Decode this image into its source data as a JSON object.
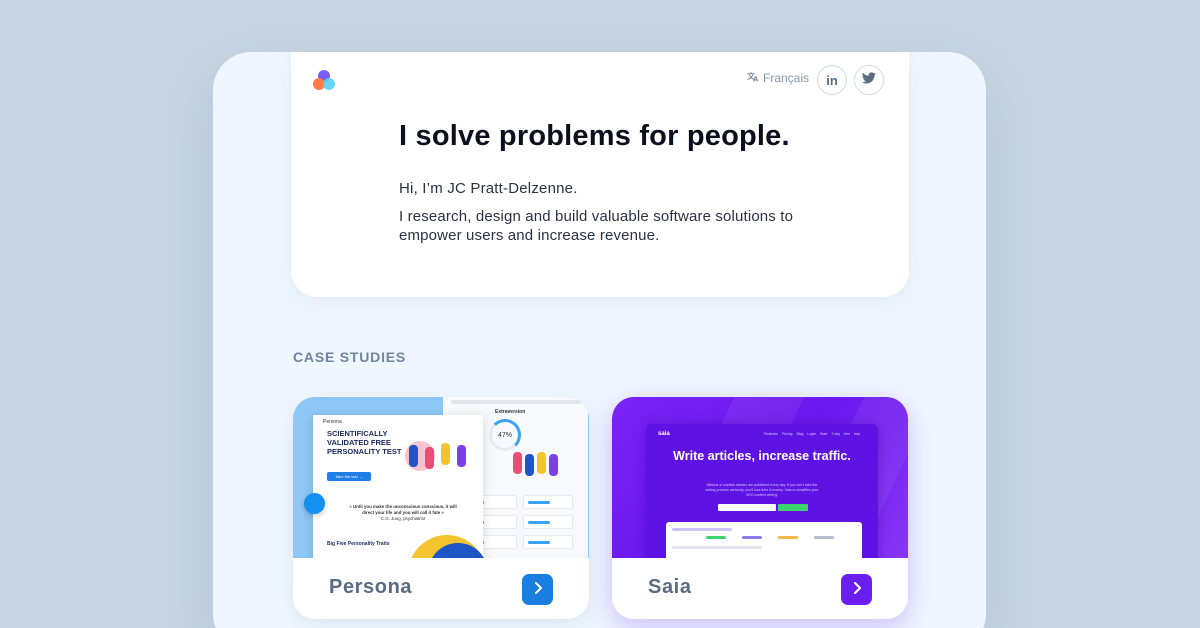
{
  "header": {
    "language_label": "Français",
    "social": {
      "linkedin_label": "in"
    }
  },
  "hero": {
    "title": "I solve problems for people.",
    "intro": "Hi, I’m JC Pratt-Delzenne.",
    "description": "I research, design and build valuable software solutions to empower users and increase revenue."
  },
  "case_studies": {
    "section_label": "CASE STUDIES",
    "cards": [
      {
        "title": "Persona",
        "accent": "#1a7de0",
        "thumbnail": {
          "brand": "Persona",
          "headline": "SCIENTIFICALLY VALIDATED FREE PERSONALITY TEST",
          "cta": "Take the test →",
          "quote": "« Until you make the unconscious conscious, it will direct your life and you will call it fate »",
          "quote_author": "C.G. Jung, psychiatrist",
          "section": "Big Five Personality Traits",
          "gauge_title": "Extraversion",
          "gauge_value": "47%"
        }
      },
      {
        "title": "Saia",
        "accent": "#6a1ff0",
        "thumbnail": {
          "brand": "saia",
          "nav": "Features Pricing Blog Login Start 7-day free trial",
          "headline": "Write articles, increase traffic.",
          "text": "Millions of useless articles are published every day. If you don't take the writing process seriously, you'll lose time & money. Saia.io simplifies your SEO content writing."
        }
      }
    ]
  },
  "colors": {
    "page_bg": "#c8d6e3",
    "device_bg": "#eff6fd",
    "title_text": "#0c0f1c",
    "section_label": "#6f84a0"
  },
  "icons": [
    "logo-icon",
    "translate-icon",
    "linkedin-icon",
    "twitter-icon",
    "chevron-right-icon"
  ]
}
